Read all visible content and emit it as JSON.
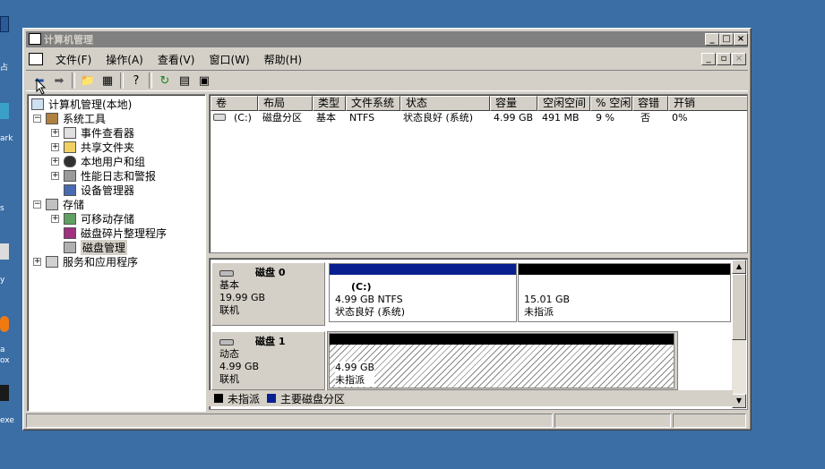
{
  "desktop": {
    "labels": [
      "占",
      "ark",
      "s",
      "y",
      "a",
      "ox",
      "exe"
    ]
  },
  "window": {
    "title": "计算机管理"
  },
  "menu": [
    "文件(F)",
    "操作(A)",
    "查看(V)",
    "窗口(W)",
    "帮助(H)"
  ],
  "tree": {
    "root": "计算机管理(本地)",
    "system_tools": "系统工具",
    "event_viewer": "事件查看器",
    "shared_folders": "共享文件夹",
    "local_users": "本地用户和组",
    "perf_logs": "性能日志和警报",
    "device_manager": "设备管理器",
    "storage": "存储",
    "removable": "可移动存储",
    "defrag": "磁盘碎片整理程序",
    "disk_mgmt": "磁盘管理",
    "services": "服务和应用程序"
  },
  "volume_list": {
    "headers": [
      "卷",
      "布局",
      "类型",
      "文件系统",
      "状态",
      "容量",
      "空闲空间",
      "% 空闲",
      "容错",
      "开销"
    ],
    "row": [
      "(C:)",
      "磁盘分区",
      "基本",
      "NTFS",
      "状态良好 (系统)",
      "4.99 GB",
      "491 MB",
      "9 %",
      "否",
      "0%"
    ]
  },
  "disks": [
    {
      "name": "磁盘 0",
      "type": "基本",
      "size": "19.99 GB",
      "state": "联机",
      "partitions": [
        {
          "name": "(C:)",
          "size": "4.99 GB NTFS",
          "status": "状态良好 (系统)",
          "color": "#0a1f8f"
        },
        {
          "name": "",
          "size": "15.01 GB",
          "status": "未指派",
          "color": "#000000"
        }
      ]
    },
    {
      "name": "磁盘 1",
      "type": "动态",
      "size": "4.99 GB",
      "state": "联机",
      "partitions": [
        {
          "name": "",
          "size": "4.99 GB",
          "status": "未指派",
          "color": "#000000"
        }
      ]
    }
  ],
  "legend": [
    {
      "label": "未指派",
      "color": "#000000"
    },
    {
      "label": "主要磁盘分区",
      "color": "#0a1f8f"
    }
  ]
}
